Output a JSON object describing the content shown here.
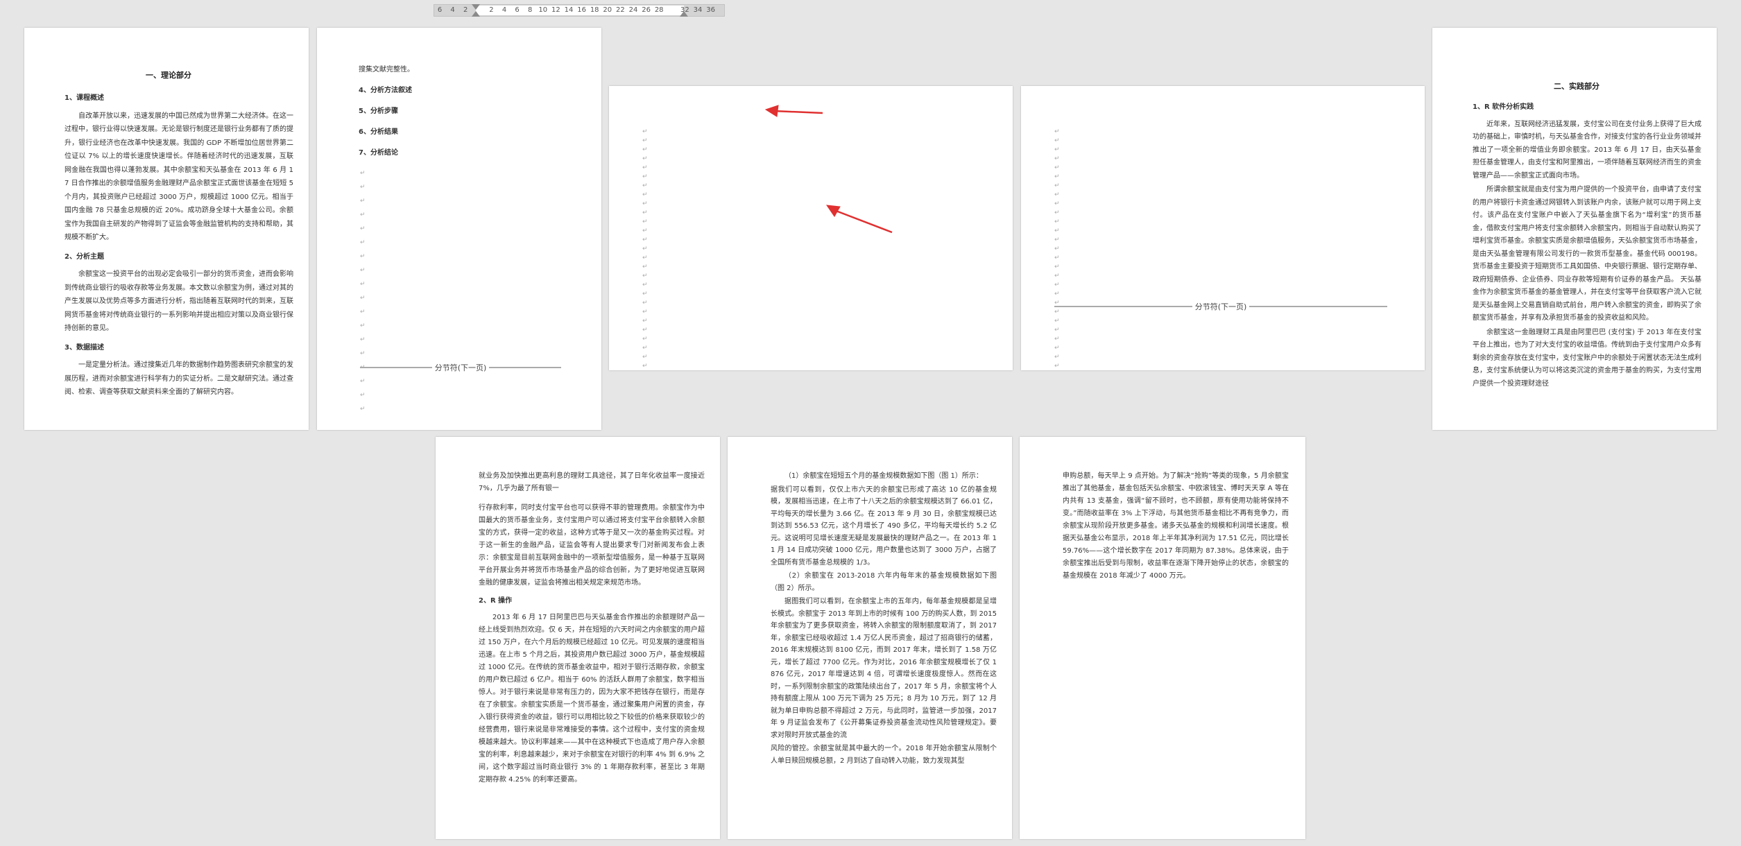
{
  "ruler": {
    "ticks": [
      "6",
      "4",
      "2",
      "",
      "2",
      "4",
      "6",
      "8",
      "10",
      "12",
      "14",
      "16",
      "18",
      "20",
      "22",
      "24",
      "26",
      "28",
      "",
      "32",
      "34",
      "36"
    ]
  },
  "pages": {
    "p1": {
      "title": "一、理论部分",
      "h1": "1、课程概述",
      "para1": "自改革开放以来，迅速发展的中国已然成为世界第二大经济体。在这一过程中，银行业得以快速发展。无论是银行制度还是银行业务都有了质的提升，银行业经济也在改革中快速发展。我国的 GDP 不断增加位居世界第二位证以 7% 以上的增长速度快速增长。伴随着经济时代的迅速发展，互联网金融在我国也得以蓬勃发展。其中余额宝和天弘基金在 2013 年 6 月 17 日合作推出的余额增值服务金融理财产品余额宝正式面世该基金在短短 5 个月内，其投资账户已经超过 3000 万户，规模超过 1000 亿元。相当于国内金融 78 只基金总规模的近 20%。成功跻身全球十大基金公司。余额宝作为我国自主研发的产物得到了证监会等金融监管机构的支持和帮助，其规模不断扩大。",
      "h2": "2、分析主题",
      "para2": "余额宝这一投资平台的出现必定会吸引一部分的货币资金，进而会影响到传统商业银行的吸收存款等业务发展。本文数以余额宝为例，通过对其的产生发展以及优势点等多方面进行分析，指出随着互联网时代的到来，互联网货币基金将对传统商业银行的一系列影响并提出相应对策以及商业银行保持创新的意见。",
      "h3": "3、数据描述",
      "para3": "一是定量分析法。通过搜集近几年的数据制作趋势图表研究余额宝的发展历程，进而对余额宝进行科学有力的实证分析。二是文献研究法。通过查阅、检索、调查等获取文献资料来全面的了解研究内容。"
    },
    "p2": {
      "line0": "搜集文献完整性。",
      "h4": "4、分析方法叙述",
      "h5": "5、分析步骤",
      "h6": "6、分析结果",
      "h7": "7、分析结论",
      "section_break": "分节符(下一页)"
    },
    "p4": {
      "section_break": "分节符(下一页)"
    },
    "p5": {
      "title": "二、实践部分",
      "h1": "1、R 软件分析实践",
      "para1": "近年来，互联网经济迅猛发展，支付宝公司在支付业务上获得了巨大成功的基础上，审慎时机，与天弘基金合作，对接支付宝的各行业业务领域并推出了一项全新的增值业务即余额宝。2013 年 6 月 17 日，由天弘基金担任基金管理人，由支付宝和阿里推出，一项伴随着互联网经济而生的资金管理产品——余额宝正式面向市场。",
      "para2": "所谓余额宝就是由支付宝为用户提供的一个投资平台，由申请了支付宝的用户将银行卡资金通过网银转入到该账户内余，该账户就可以用于网上支付。该产品在支付宝账户中嵌入了天弘基金旗下名为“增利宝”的货币基金，借款支付宝用户将支付宝余额转入余额宝内，则相当于自动默认购买了增利宝货币基金。余额宝实质是余额增值服务，天弘余额宝货币市场基金，是由天弘基金管理有限公司发行的一款货币型基金。基金代码 000198。货币基金主要投资于短期货币工具如国债、中央银行票据、银行定期存单、政府短期债券、企业债券、同业存款等短期有价证券的基金产品。 天弘基金作为余额宝货币基金的基金管理人，并在支付宝等平台获取客户流入它就是天弘基金网上交易直销自助式前台，用户转入余额宝的资金，即购买了余额宝货币基金，并享有及承担货币基金的投资收益和风险。",
      "para3": "余额宝这一金融理财工具是由阿里巴巴 (支付宝) 于 2013 年在支付宝平台上推出，也为了对大支付宝的收益增值。传统到由于支付宝用户众多有剩余的资金存放在支付宝中，支付宝账户中的余额处于闲置状态无法生成利息，支付宝系统便认为可以将这类沉淀的资金用于基金的购买，为支付宝用户提供一个投资理财途径"
    },
    "p6": {
      "para1": "就业务及加快推出更高利息的理财工具途径，其了日年化收益率一度接近 7%，几乎为最了所有银一",
      "para2": "行存款利率，同时支付宝平台也可以获得不菲的管理费用。余额宝作为中国最大的货币基金业务，支付宝用户可以通过将支付宝平台余额转入余额宝的方式，获得一定的收益，这种方式等于是又一次的基金购买过程。对于这一新生的金融产品，证监会等有人提出要求专门对新闻发布会上表示：余额宝是目前互联网金融中的一项新型增值服务，是一种基于互联网平台开展业务并将货币市场基金产品的综合创新，为了更好地促进互联网金融的健康发展，证监会将推出相关规定来规范市场。",
      "h2": "2、R 操作",
      "para3": "2013 年 6 月 17 日阿里巴巴与天弘基金合作推出的余额理财产品一经上线受到热烈欢迎。仅 6 天，并在短短的六天时间之内余额宝的用户超过 150 万户，在六个月后的规模已经超过 10 亿元。可见发展的速度相当迅速。在上市 5 个月之后，其投资用户数已超过 3000 万户，基金规模超过 1000 亿元。在传统的货币基金收益中，相对于银行活期存款，余额宝的用户数已超过 6 亿户。相当于 60% 的活跃人群用了余额宝，数字相当惊人。对于银行来说是非常有压力的，因为大家不把钱存在银行，而是存在了余额宝。余额宝实质是一个货币基金，通过聚集用户闲置的资金，存入银行获得资金的收益，银行可以用相比较之下较低的价格来获取较少的经营费用，银行来说是非常难接受的事情。这个过程中，支付宝的资金规模越来越大。协议利率越来——其中在这种模式下也造成了用户存入余额宝的利率，利息越来越少，来对于余额宝在对银行的利率 4% 到 6.9% 之间，这个数字超过当时商业银行 3% 的 1 年期存款利率，甚至比 3 年期定期存款 4.25% 的利率还要高。"
    },
    "p7": {
      "para1": "（1）余额宝在短短五个月的基金规模数据如下图（图 1）所示：",
      "para2": "据我们可以看到，仅仅上市六天的余额宝已形成了高达 10 亿的基金规模，发展相当迅速，在上市了十八天之后的余额宝规模达到了 66.01 亿，平均每天的增长量为 3.66 亿。在 2013 年 9 月 30 日，余额宝规模已达到达到 556.53 亿元，这个月增长了 490 多亿，平均每天增长约 5.2 亿元。这说明可见增长速度无疑是发展最快的理财产品之一。在 2013 年 11 月 14 日成功突破 1000 亿元，用户数量也达到了 3000 万户，占据了全国所有货币基金总规模的 1/3。",
      "para3": "（2）余额宝在 2013-2018 六年内每年末的基金规模数据如下图（图 2）所示。",
      "para4": "据图我们可以看到，在余额宝上市的五年内，每年基金规模都是呈增长模式。余额宝于 2013 年到上市的时候有 100 万的购买人数，到 2015 年余额宝为了更多获取资金，将转入余额宝的限制额度取消了，到 2017 年，余额宝已经吸收超过 1.4 万亿人民币资金，超过了招商银行的储蓄，2016 年末规模达到 8100 亿元，而到 2017 年末，增长到了 1.58 万亿元，增长了超过 7700 亿元。作为对比，2016 年余额宝规模增长了仅 1876 亿元，2017 年增速达到 4 倍，可谓增长速度极度惊人。然而在这时，一系列限制余额宝的政策陆续出台了，2017 年 5 月，余额宝将个人持有额度上限从 100 万元下调为 25 万元；8 月为 10 万元，到了 12 月就为单日申购总额不得超过 2 万元，与此同时，监管进一步加强，2017 年 9 月证监会发布了《公开募集证券投资基金流动性风险管理规定》。要求对限时开放式基金的流",
      "para5": "风险的管控。余额宝就是其中最大的一个。2018 年开始余额宝从限制个人单日赎回规模总额，2 月到达了自动转入功能，致力发现其型"
    },
    "p8": {
      "para1": "申购总额，每天早上 9 点开始。为了解决“抢购”等类的现象，5 月余额宝推出了其他基金，基金包括天弘余额宝、中欧滚钱宝、博时天天享 A 等在内共有 13 支基金，强调“留不顾时，也不顾额，原有使用功能将保持不变。”而随收益率在 3% 上下浮动，与其他货币基金相比不再有竞争力，而余额宝从现阶段开放更多基金。诸多天弘基金的规模和利润增长速度。根据天弘基金公布显示，2018 年上半年其净利润为 17.51 亿元，同比增长 59.76%——这个增长数字在 2017 年同期为 87.38%。总体来说，由于余额宝推出后受到与限制，收益率在逐渐下降开始停止的状态，余额宝的基金规模在 2018 年减少了 4000 万元。"
    }
  }
}
